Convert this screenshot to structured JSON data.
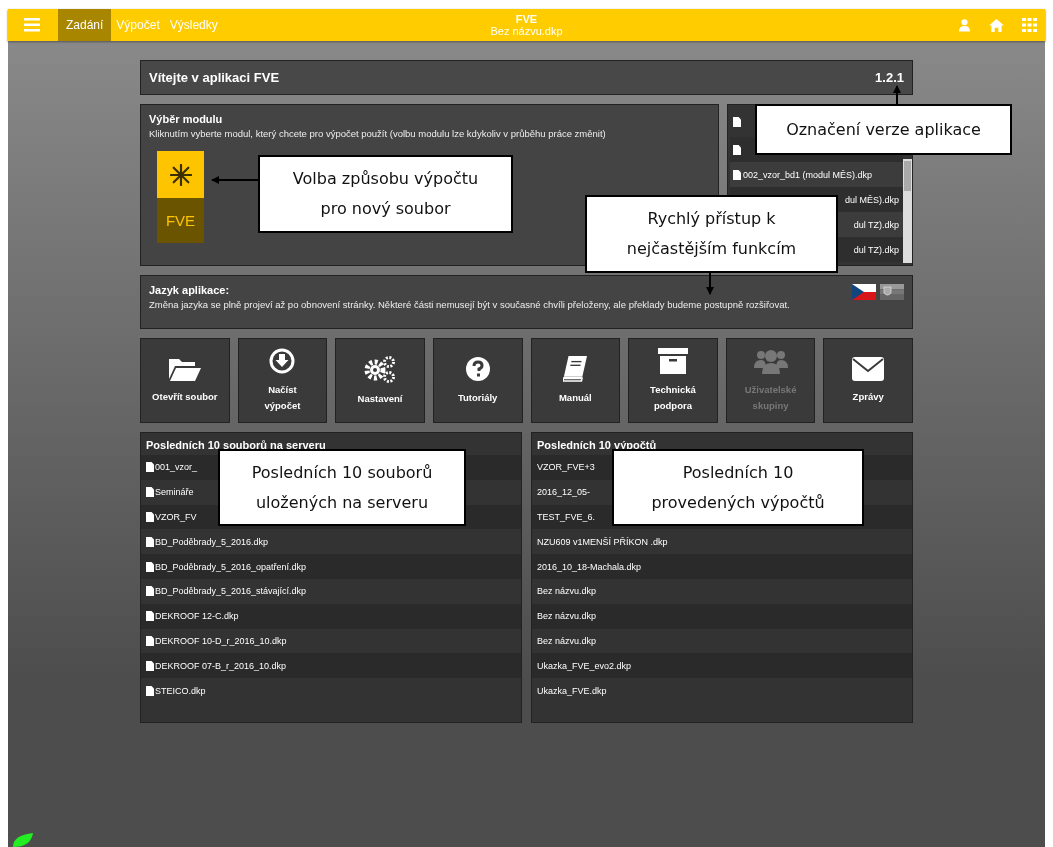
{
  "header": {
    "tabs": [
      {
        "label": "Zadání",
        "selected": true
      },
      {
        "label": "Výpočet",
        "selected": false
      },
      {
        "label": "Výsledky",
        "selected": false
      }
    ],
    "title": "FVE",
    "subtitle": "Bez názvu.dkp"
  },
  "welcome": {
    "title": "Vítejte v aplikaci FVE",
    "version": "1.2.1"
  },
  "module_panel": {
    "title": "Výběr modulu",
    "hint": "Kliknutím vyberte modul, který chcete pro výpočet použít (volbu modulu lze kdykoliv v průběhu práce změnit)",
    "module": {
      "label": "FVE",
      "selected": true
    }
  },
  "module_files": [
    {
      "kind": "file"
    },
    {
      "kind": "file"
    },
    {
      "kind": "file",
      "name": "002_vzor_bd1 (modul MĚS).dkp"
    },
    {
      "kind": "fragment",
      "name": "dul MĚS).dkp"
    },
    {
      "kind": "fragment",
      "name": "dul TZ).dkp"
    },
    {
      "kind": "fragment",
      "name": "dul TZ).dkp"
    }
  ],
  "language": {
    "title": "Jazyk aplikace:",
    "text": "Změna jazyka se plně projeví až po obnovení stránky. Některé části nemusejí být v současné chvíli přeloženy, ale překlady budeme postupně rozšiřovat."
  },
  "actions": [
    {
      "kind": "folder",
      "label": "Otevřít soubor",
      "disabled": false
    },
    {
      "kind": "download",
      "label": "Načíst výpočet",
      "disabled": false
    },
    {
      "kind": "gears",
      "label": "Nastavení",
      "disabled": false
    },
    {
      "kind": "help",
      "label": "Tutoriály",
      "disabled": false
    },
    {
      "kind": "book",
      "label": "Manuál",
      "disabled": false
    },
    {
      "kind": "archive",
      "label": "Technická podpora",
      "disabled": false
    },
    {
      "kind": "users",
      "label": "Uživatelské skupiny",
      "disabled": true
    },
    {
      "kind": "mail",
      "label": "Zprávy",
      "disabled": false
    }
  ],
  "recent_files": {
    "title": "Posledních 10 souborů na serveru",
    "items": [
      "001_vzor_",
      "Semináře",
      "VZOR_FV",
      "BD_Poděbrady_5_2016.dkp",
      "BD_Poděbrady_5_2016_opatření.dkp",
      "BD_Poděbrady_5_2016_stávající.dkp",
      "DEKROOF 12-C.dkp",
      "DEKROOF 10-D_r_2016_10.dkp",
      "DEKROOF 07-B_r_2016_10.dkp",
      "STEICO.dkp"
    ]
  },
  "recent_calcs": {
    "title": "Posledních 10 výpočtů",
    "items": [
      "VZOR_FVE+3",
      "2016_12_05-",
      "TEST_FVE_6.",
      "NZU609 v1MENŠÍ PŘÍKON .dkp",
      "2016_10_18-Machala.dkp",
      "Bez názvu.dkp",
      "Bez názvu.dkp",
      "Bez názvu.dkp",
      "Ukazka_FVE_evo2.dkp",
      "Ukazka_FVE.dkp"
    ]
  },
  "callouts": [
    {
      "text": "Označení verze aplikace"
    },
    {
      "text": "Volba způsobu výpočtu pro nový soubor"
    },
    {
      "text": "Rychlý přístup k nejčastějším funkcím"
    },
    {
      "text": "Posledních 10 souborů uložených na serveru"
    },
    {
      "text": "Posledních 10 provedených výpočtů"
    }
  ]
}
